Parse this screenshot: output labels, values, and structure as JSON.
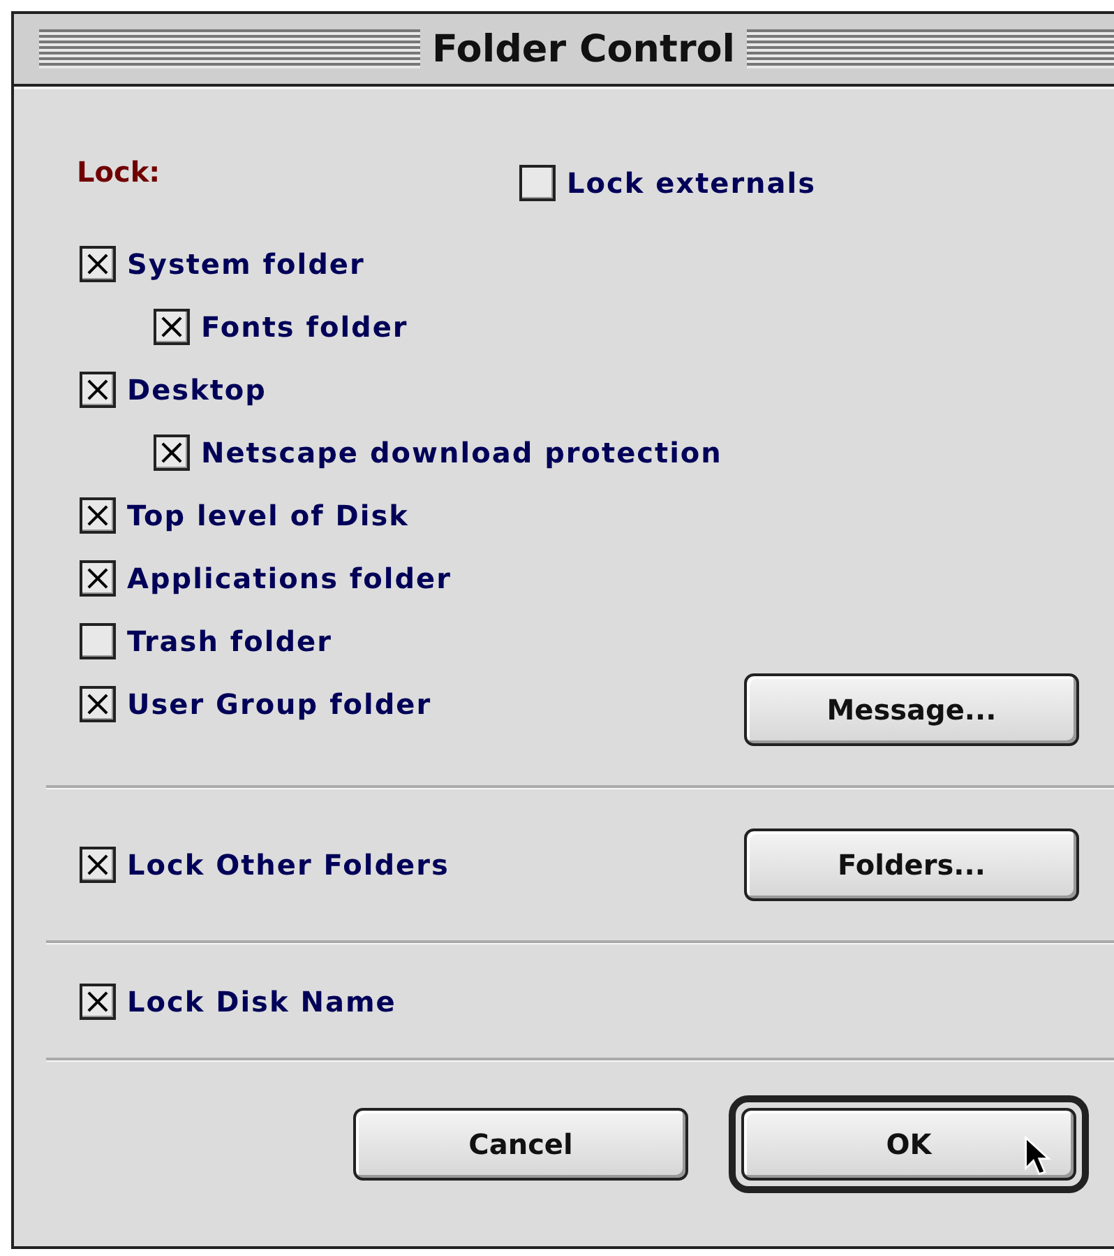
{
  "window": {
    "title": "Folder Control"
  },
  "lock_label": "Lock:",
  "lock_externals": {
    "label": "Lock externals",
    "checked": false
  },
  "items": [
    {
      "label": "System folder",
      "checked": true,
      "children": [
        {
          "label": "Fonts folder",
          "checked": true
        }
      ]
    },
    {
      "label": "Desktop",
      "checked": true,
      "children": [
        {
          "label": "Netscape download protection",
          "checked": true
        }
      ]
    },
    {
      "label": "Top level of Disk",
      "checked": true
    },
    {
      "label": "Applications folder",
      "checked": true
    },
    {
      "label": "Trash folder",
      "checked": false
    },
    {
      "label": "User Group folder",
      "checked": true
    }
  ],
  "message_button": "Message...",
  "other_folders": {
    "label": "Lock Other Folders",
    "checked": true
  },
  "folders_button": "Folders...",
  "disk_name": {
    "label": "Lock Disk Name",
    "checked": true
  },
  "buttons": [
    {
      "label": "Cancel",
      "default": false
    },
    {
      "label": "OK",
      "default": true
    }
  ]
}
